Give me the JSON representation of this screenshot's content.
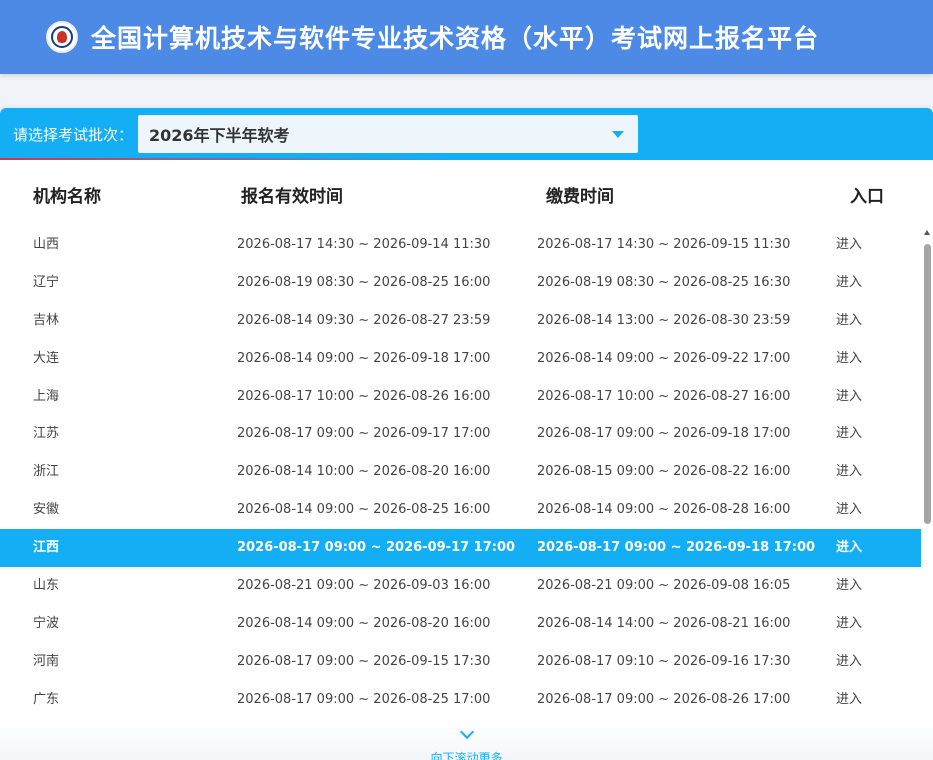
{
  "header": {
    "title": "全国计算机技术与软件专业技术资格（水平）考试网上报名平台"
  },
  "batch": {
    "label": "请选择考试批次：",
    "selected": "2026年下半年软考"
  },
  "table": {
    "headers": [
      "机构名称",
      "报名有效时间",
      "缴费时间",
      "入口"
    ],
    "rows": [
      {
        "org": "山西",
        "reg": "2026-08-17 14:30 ~ 2026-09-14 11:30",
        "pay": "2026-08-17 14:30 ~ 2026-09-15 11:30",
        "entry": "进入"
      },
      {
        "org": "辽宁",
        "reg": "2026-08-19 08:30 ~ 2026-08-25 16:00",
        "pay": "2026-08-19 08:30 ~ 2026-08-25 16:30",
        "entry": "进入"
      },
      {
        "org": "吉林",
        "reg": "2026-08-14 09:30 ~ 2026-08-27 23:59",
        "pay": "2026-08-14 13:00 ~ 2026-08-30 23:59",
        "entry": "进入"
      },
      {
        "org": "大连",
        "reg": "2026-08-14 09:00 ~ 2026-09-18 17:00",
        "pay": "2026-08-14 09:00 ~ 2026-09-22 17:00",
        "entry": "进入"
      },
      {
        "org": "上海",
        "reg": "2026-08-17 10:00 ~ 2026-08-26 16:00",
        "pay": "2026-08-17 10:00 ~ 2026-08-27 16:00",
        "entry": "进入"
      },
      {
        "org": "江苏",
        "reg": "2026-08-17 09:00 ~ 2026-09-17 17:00",
        "pay": "2026-08-17 09:00 ~ 2026-09-18 17:00",
        "entry": "进入"
      },
      {
        "org": "浙江",
        "reg": "2026-08-14 10:00 ~ 2026-08-20 16:00",
        "pay": "2026-08-15 09:00 ~ 2026-08-22 16:00",
        "entry": "进入"
      },
      {
        "org": "安徽",
        "reg": "2026-08-14 09:00 ~ 2026-08-25 16:00",
        "pay": "2026-08-14 09:00 ~ 2026-08-28 16:00",
        "entry": "进入"
      },
      {
        "org": "江西",
        "reg": "2026-08-17 09:00 ~ 2026-09-17 17:00",
        "pay": "2026-08-17 09:00 ~ 2026-09-18 17:00",
        "entry": "进入"
      },
      {
        "org": "山东",
        "reg": "2026-08-21 09:00 ~ 2026-09-03 16:00",
        "pay": "2026-08-21 09:00 ~ 2026-09-08 16:05",
        "entry": "进入"
      },
      {
        "org": "宁波",
        "reg": "2026-08-14 09:00 ~ 2026-08-20 16:00",
        "pay": "2026-08-14 14:00 ~ 2026-08-21 16:00",
        "entry": "进入"
      },
      {
        "org": "河南",
        "reg": "2026-08-17 09:00 ~ 2026-09-15 17:30",
        "pay": "2026-08-17 09:10 ~ 2026-09-16 17:30",
        "entry": "进入"
      },
      {
        "org": "广东",
        "reg": "2026-08-17 09:00 ~ 2026-08-25 17:00",
        "pay": "2026-08-17 09:00 ~ 2026-08-26 17:00",
        "entry": "进入"
      }
    ]
  },
  "more": {
    "label": "向下滚动更多",
    "icon": "chevron-down-icon"
  },
  "colors": {
    "header_bg": "#4d8ae6",
    "accent": "#14aef5",
    "highlight_row": "#14aef5"
  }
}
